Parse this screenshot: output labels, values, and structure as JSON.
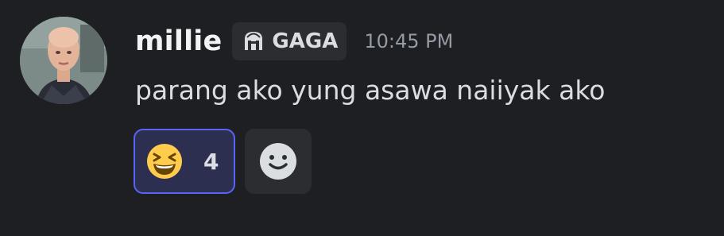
{
  "message": {
    "username": "millie",
    "server_tag": "GAGA",
    "server_tag_icon": "crest-icon",
    "timestamp": "10:45 PM",
    "text": "parang ako yung asawa naiiyak ako"
  },
  "reactions": [
    {
      "emoji": "laughing-face-emoji",
      "count": "4",
      "selected": true
    }
  ],
  "add_reaction": {
    "icon": "smile-icon"
  },
  "colors": {
    "background": "#1e1f22",
    "username": "#f2f3f5",
    "text": "#dbdee1",
    "timestamp": "#949ba4",
    "reaction_selected_border": "#5865f2",
    "reaction_selected_bg": "#2c2f4f"
  }
}
